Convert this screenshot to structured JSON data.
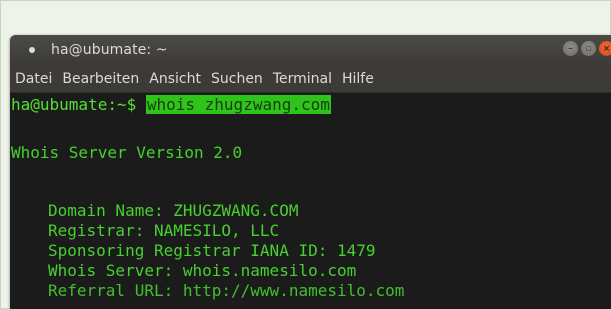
{
  "window": {
    "title": "ha@ubumate: ~"
  },
  "menu": {
    "items": [
      "Datei",
      "Bearbeiten",
      "Ansicht",
      "Suchen",
      "Terminal",
      "Hilfe"
    ]
  },
  "terminal": {
    "prompt": "ha@ubumate:~$ ",
    "command": "whois zhugzwang.com",
    "server_line": "Whois Server Version 2.0",
    "records": [
      "Domain Name: ZHUGZWANG.COM",
      "Registrar: NAMESILO, LLC",
      "Sponsoring Registrar IANA ID: 1479",
      "Whois Server: whois.namesilo.com",
      "Referral URL: http://www.namesilo.com"
    ]
  },
  "colors": {
    "terminal_text": "#46d12e",
    "terminal_bg": "#1b1b1b",
    "titlebar": "#3c3b37",
    "close_button": "#e95420"
  }
}
